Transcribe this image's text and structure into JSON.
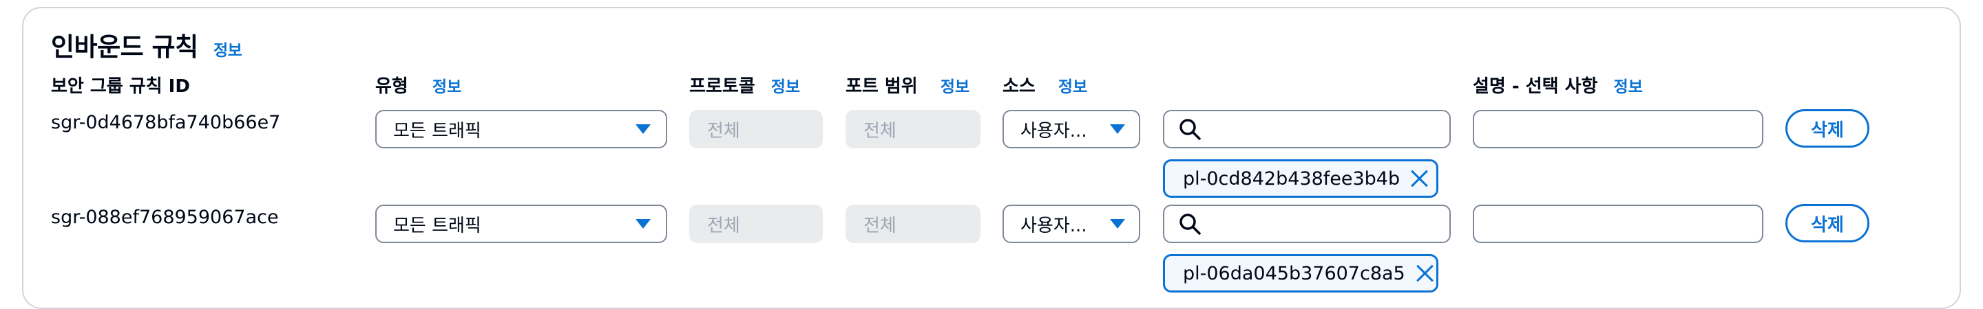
{
  "section": {
    "title": "인바운드 규칙",
    "info": "정보"
  },
  "columns": {
    "rule_id": "보안 그룹 규칙 ID",
    "type": "유형",
    "protocol": "프로토콜",
    "port_range": "포트 범위",
    "source": "소스",
    "description": "설명 - 선택 사항",
    "info": "정보"
  },
  "rows": [
    {
      "rule_id": "sgr-0d4678bfa740b66e7",
      "type": "모든 트래픽",
      "protocol": "전체",
      "port_range": "전체",
      "source_type": "사용자...",
      "search_value": "",
      "token": "pl-0cd842b438fee3b4b",
      "description": "",
      "delete": "삭제"
    },
    {
      "rule_id": "sgr-088ef768959067ace",
      "type": "모든 트래픽",
      "protocol": "전체",
      "port_range": "전체",
      "source_type": "사용자...",
      "search_value": "",
      "token": "pl-06da045b37607c8a5",
      "description": "",
      "delete": "삭제"
    }
  ],
  "colors": {
    "accent": "#0972d3",
    "disabled_bg": "#e9ebed",
    "border": "#7d8998"
  }
}
